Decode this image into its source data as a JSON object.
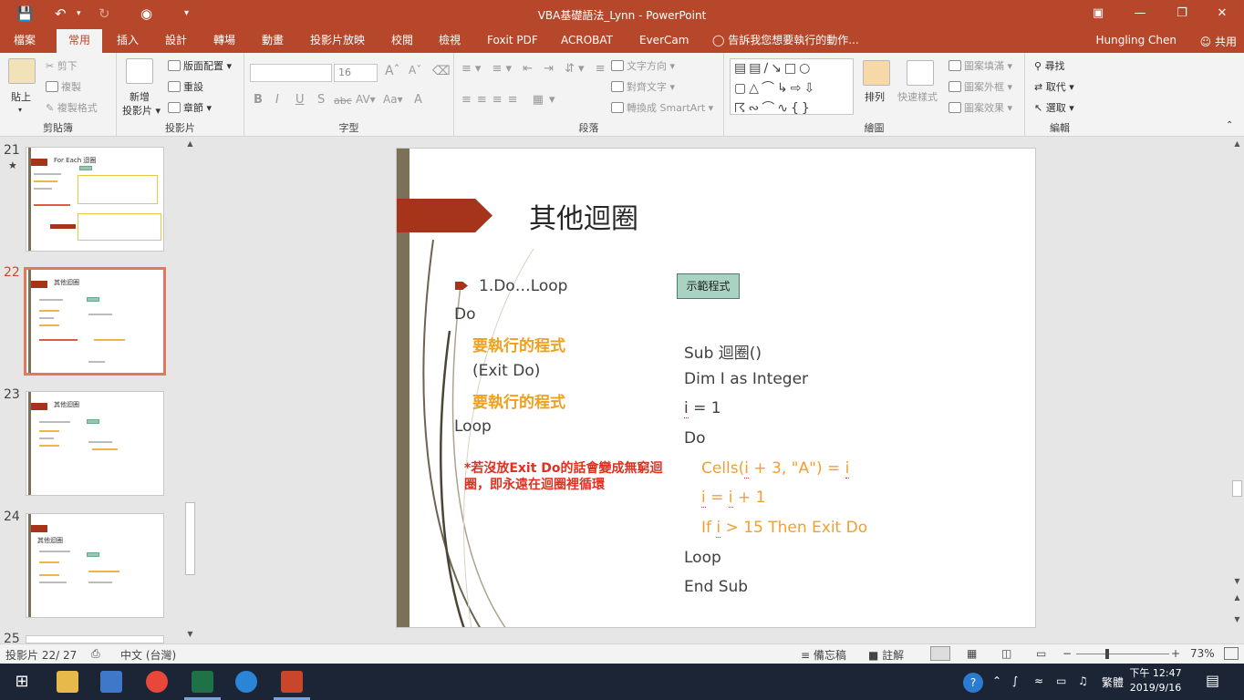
{
  "app": {
    "title": "VBA基礎語法_Lynn  -  PowerPoint",
    "user": "Hungling Chen",
    "share": "共用",
    "search_placeholder": "告訴我您想要執行的動作..."
  },
  "tabs": [
    "檔案",
    "常用",
    "插入",
    "設計",
    "轉場",
    "動畫",
    "投影片放映",
    "校閱",
    "檢視",
    "Foxit PDF",
    "ACROBAT",
    "EverCam"
  ],
  "active_tab": "常用",
  "ribbon": {
    "clipboard": {
      "label": "剪貼簿",
      "paste": "貼上",
      "cut": "剪下",
      "copy": "複製",
      "format_painter": "複製格式"
    },
    "slides": {
      "label": "投影片",
      "new_slide": "新增",
      "new_slide2": "投影片",
      "layout": "版面配置",
      "reset": "重設",
      "section": "章節"
    },
    "font": {
      "label": "字型",
      "size": "16"
    },
    "paragraph": {
      "label": "段落",
      "text_direction": "文字方向",
      "align_text": "對齊文字",
      "smartart": "轉換成 SmartArt"
    },
    "drawing": {
      "label": "繪圖",
      "arrange": "排列",
      "quick_styles": "快速樣式",
      "shape_fill": "圖案填滿",
      "shape_outline": "圖案外框",
      "shape_effects": "圖案效果"
    },
    "editing": {
      "label": "編輯",
      "find": "尋找",
      "replace": "取代",
      "select": "選取"
    }
  },
  "thumbnails": [
    {
      "number": "21",
      "title": "For Each 迴圈",
      "star": "★"
    },
    {
      "number": "22",
      "title": "其他迴圈"
    },
    {
      "number": "23",
      "title": "其他迴圈"
    },
    {
      "number": "24",
      "title": "其他迴圈"
    },
    {
      "number": "25"
    }
  ],
  "slide": {
    "title": "其他迴圈",
    "bullet": "1.Do…Loop",
    "left_lines": [
      "Do",
      "要執行的程式",
      "(Exit Do)",
      "要執行的程式",
      "Loop"
    ],
    "note": "*若沒放Exit Do的話會變成無窮迴圈，即永遠在迴圈裡循環",
    "demo_button": "示範程式",
    "code": {
      "sub": "Sub 迴圈()",
      "dim": "Dim I as Integer",
      "assign_var": "i",
      "assign_rest": " = 1",
      "do": "Do",
      "cells_a": "Cells(",
      "cells_i": "i",
      "cells_b": " + 3, \"A\") = ",
      "cells_c": "i",
      "inc_a": "i",
      "inc_b": " = ",
      "inc_c": "i",
      "inc_d": " + 1",
      "if_a": "If ",
      "if_i": "i",
      "if_b": " > 15 Then Exit Do",
      "loop": "Loop",
      "end": "End Sub"
    }
  },
  "status": {
    "slide_info": "投影片 22/ 27",
    "language": "中文 (台灣)",
    "notes": "備忘稿",
    "comments": "註解",
    "zoom": "73%"
  },
  "taskbar": {
    "time": "下午 12:47",
    "date": "2019/9/16",
    "ime": "繁體"
  }
}
